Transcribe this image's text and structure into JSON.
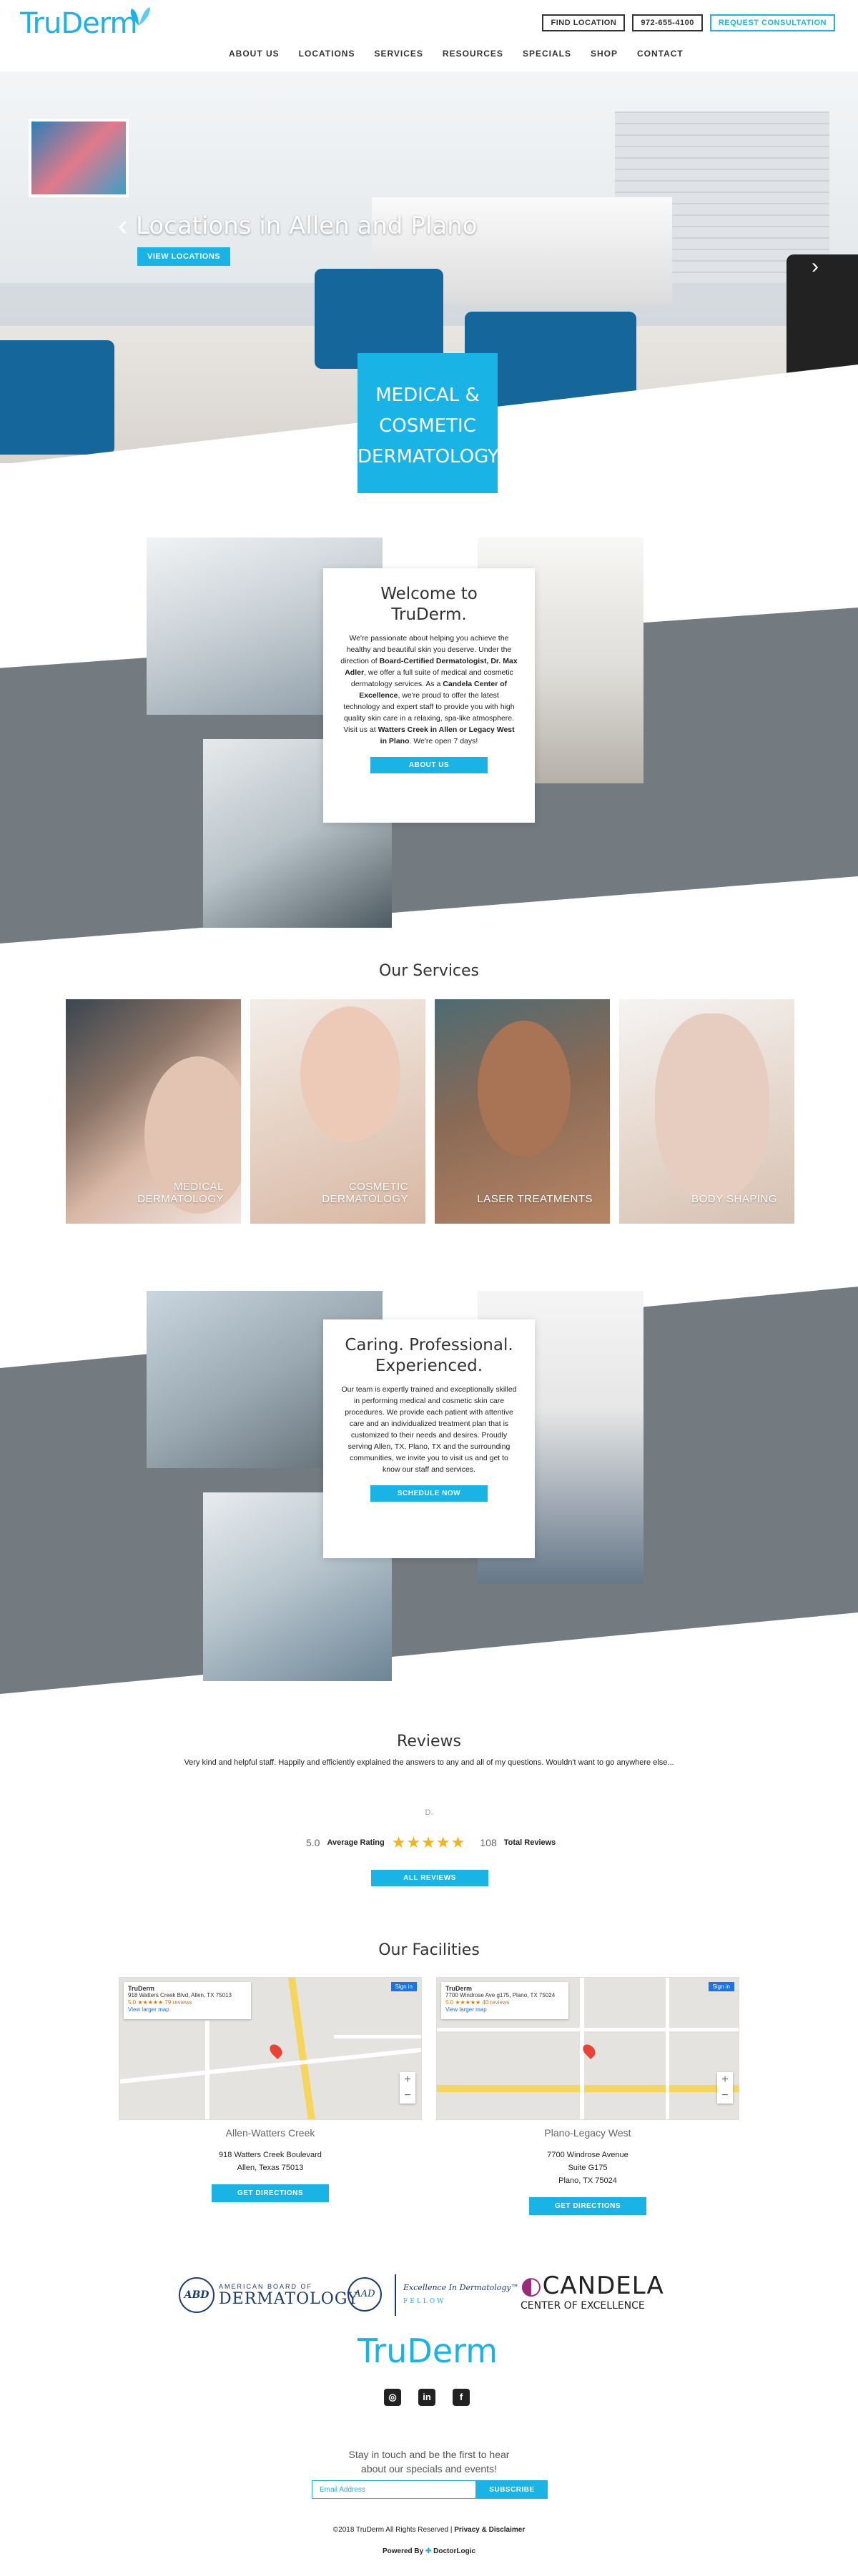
{
  "brand": {
    "logo_text": "TruDerm",
    "accent_color": "#1ab3e6"
  },
  "header": {
    "find_location": "FIND LOCATION",
    "phone": "972-655-4100",
    "request_consultation": "REQUEST CONSULTATION",
    "nav": [
      "ABOUT US",
      "LOCATIONS",
      "SERVICES",
      "RESOURCES",
      "SPECIALS",
      "SHOP",
      "CONTACT"
    ]
  },
  "hero": {
    "title": "Locations in Allen and Plano",
    "button": "VIEW LOCATIONS",
    "arrow_left": "‹",
    "arrow_right": "›",
    "feature_box": [
      "MEDICAL &",
      "COSMETIC",
      "DERMATOLOGY"
    ]
  },
  "welcome": {
    "title": "Welcome to TruDerm.",
    "p1": "We're passionate about helping you achieve the healthy and beautiful skin you deserve. Under the direction of ",
    "b1": "Board-Certified Dermatologist, Dr. Max Adler",
    "p2": ", we offer a full suite of medical and cosmetic dermatology services. As a ",
    "b2": "Candela Center of Excellence",
    "p3": ", we're proud to offer the latest technology and expert staff to provide you with high quality skin care in a relaxing, spa-like atmosphere. Visit us at ",
    "b3": "Watters Creek in Allen or Legacy West in Plano",
    "p4": ". We're open 7 days!",
    "button": "ABOUT US"
  },
  "services": {
    "title": "Our Services",
    "items": [
      {
        "label": "MEDICAL DERMATOLOGY"
      },
      {
        "label": "COSMETIC DERMATOLOGY"
      },
      {
        "label": "LASER TREATMENTS"
      },
      {
        "label": "BODY SHAPING"
      }
    ]
  },
  "team": {
    "title": "Caring. Professional. Experienced.",
    "body": "Our team is expertly trained and exceptionally skilled in performing medical and cosmetic skin care procedures. We provide each patient with attentive care and an individualized treatment plan that is customized to their needs and desires. Proudly serving Allen, TX, Plano, TX and the surrounding communities, we invite you to visit us and get to know our staff and services.",
    "button": "SCHEDULE NOW"
  },
  "reviews": {
    "title": "Reviews",
    "quote": "Very kind and helpful staff. Happily and efficiently explained the answers to any and all of my questions. Wouldn't want to go anywhere else...",
    "reviewer_mark": "D.",
    "average": "5.0",
    "average_label": "Average Rating",
    "rating": 5,
    "stars": "★★★★★",
    "total": "108",
    "total_label": "Total Reviews",
    "button": "ALL REVIEWS"
  },
  "facilities": {
    "title": "Our Facilities",
    "items": [
      {
        "name": "Allen-Watters Creek",
        "address1": "918 Watters Creek Boulevard",
        "address2": "Allen, Texas 75013",
        "address3": "",
        "map_title": "TruDerm",
        "map_address": "918 Watters Creek Blvd, Allen, TX 75013",
        "map_reviews": "5.0 ★★★★★ 79 reviews",
        "map_link": "View larger map",
        "button": "GET DIRECTIONS"
      },
      {
        "name": "Plano-Legacy West",
        "address1": "7700 Windrose Avenue",
        "address2": "Suite G175",
        "address3": "Plano, TX 75024",
        "map_title": "TruDerm",
        "map_address": "7700 Windrose Ave g175, Plano, TX 75024",
        "map_reviews": "5.0 ★★★★★ 40 reviews",
        "map_link": "View larger map",
        "button": "GET DIRECTIONS"
      }
    ],
    "map_signin": "Sign in"
  },
  "affiliations": {
    "abd_seal": "ABD",
    "abd_line1": "AMERICAN BOARD OF",
    "abd_line2": "DERMATOLOGY",
    "aad_seal": "AAD",
    "excellence": "Excellence In Dermatology™",
    "fellow": "FELLOW",
    "candela_name": "CANDELA",
    "candela_sub": "CENTER OF EXCELLENCE"
  },
  "social": [
    "instagram-icon",
    "linkedin-icon",
    "facebook-icon"
  ],
  "newsletter": {
    "line1": "Stay in touch and be the first to hear",
    "line2": "about our specials and events!",
    "placeholder": "Email Address",
    "button": "SUBSCRIBE"
  },
  "footer": {
    "copyright": "©2018 TruDerm All Rights Reserved | ",
    "privacy": "Privacy & Disclaimer",
    "powered": "Powered By ",
    "doctorlogic": "DoctorLogic"
  }
}
